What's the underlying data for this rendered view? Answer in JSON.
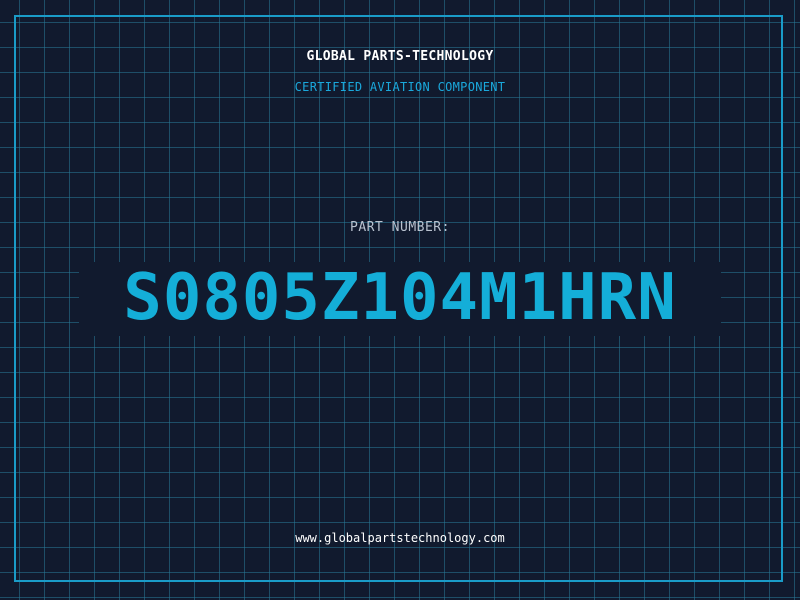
{
  "header": {
    "company": "GLOBAL PARTS-TECHNOLOGY",
    "subtitle": "CERTIFIED AVIATION COMPONENT"
  },
  "part": {
    "label": "PART NUMBER:",
    "number": "S0805Z104M1HRN"
  },
  "footer": {
    "website": "www.globalpartstechnology.com"
  },
  "colors": {
    "background": "#111a2e",
    "grid": "#28788f",
    "frame": "#1a9cc8",
    "accent": "#14aed8"
  }
}
